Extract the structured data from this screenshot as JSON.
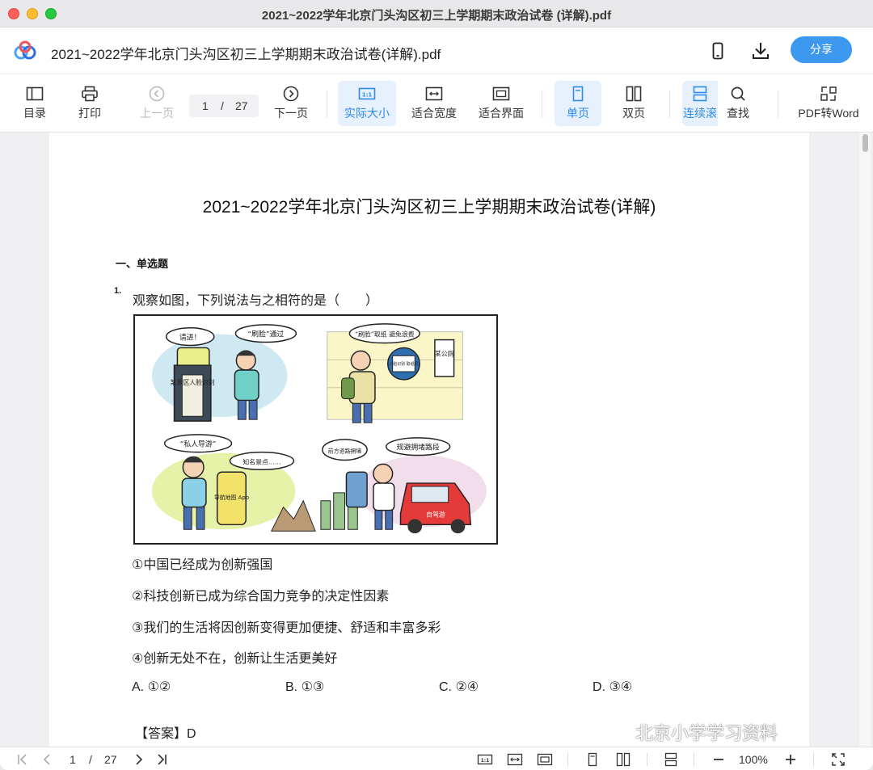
{
  "window": {
    "title": "2021~2022学年北京门头沟区初三上学期期末政治试卷 (详解).pdf"
  },
  "header": {
    "doc_name": "2021~2022学年北京门头沟区初三上学期期末政治试卷(详解).pdf",
    "share_label": "分享",
    "icons": [
      "logo-icon",
      "phone-icon",
      "download-icon"
    ]
  },
  "toolbar": {
    "toc": "目录",
    "print": "打印",
    "prev": "上一页",
    "page_current": "1",
    "page_sep": "/",
    "page_total": "27",
    "next": "下一页",
    "actual_size": "实际大小",
    "fit_width": "适合宽度",
    "fit_page": "适合界面",
    "single": "单页",
    "double": "双页",
    "continuous": "连续滚",
    "search": "查找",
    "pdf_to_word": "PDF转Word",
    "accent_color": "#2f8ae8"
  },
  "document": {
    "title": "2021~2022学年北京门头沟区初三上学期期末政治试卷(详解)",
    "section": "一、单选题",
    "q_number": "1.",
    "question": "观察如图，下列说法与之相符的是（　　）",
    "cartoon": {
      "p1_bubble_a": "请进！",
      "p1_bubble_b": "“刷脸”通过",
      "p1_machine": "某景区人脸识别",
      "p2_bubble": "“刷脸”取纸 避免浪费",
      "p2_sign": "某公厕",
      "p2_device": "人脸识别 取纸机",
      "p3_bubble_a": "“私人导游”",
      "p3_bubble_b": "知名景点……",
      "p3_phone": "导航地图 App",
      "p4_bubble_a": "前方道路拥堵",
      "p4_bubble_b": "规避拥堵路段",
      "p4_car": "自驾游"
    },
    "statements": [
      "①中国已经成为创新强国",
      "②科技创新已成为综合国力竞争的决定性因素",
      "③我们的生活将因创新变得更加便捷、舒适和丰富多彩",
      "④创新无处不在，创新让生活更美好"
    ],
    "options": [
      "A. ①②",
      "B. ①③",
      "C. ②④",
      "D. ③④"
    ],
    "answer_label": "【答案】",
    "answer_value": "D"
  },
  "watermark": "北京小学学习资料",
  "bottombar": {
    "page_current": "1",
    "page_sep": "/",
    "page_total": "27",
    "zoom": "100%"
  }
}
